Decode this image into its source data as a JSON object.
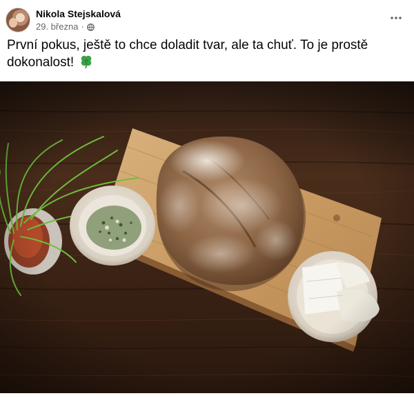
{
  "post": {
    "author_name": "Nikola Stejskalová",
    "date": "29. března",
    "separator": "·",
    "privacy_icon": "globe-icon",
    "more_icon": "more-options-icon",
    "caption": "První pokus, ještě to chce doladit tvar, ale ta chuť. To je prostě dokonalost!",
    "caption_emoji_icon": "four-leaf-clover-icon"
  },
  "colors": {
    "text_primary": "#050505",
    "text_secondary": "#65676b"
  }
}
